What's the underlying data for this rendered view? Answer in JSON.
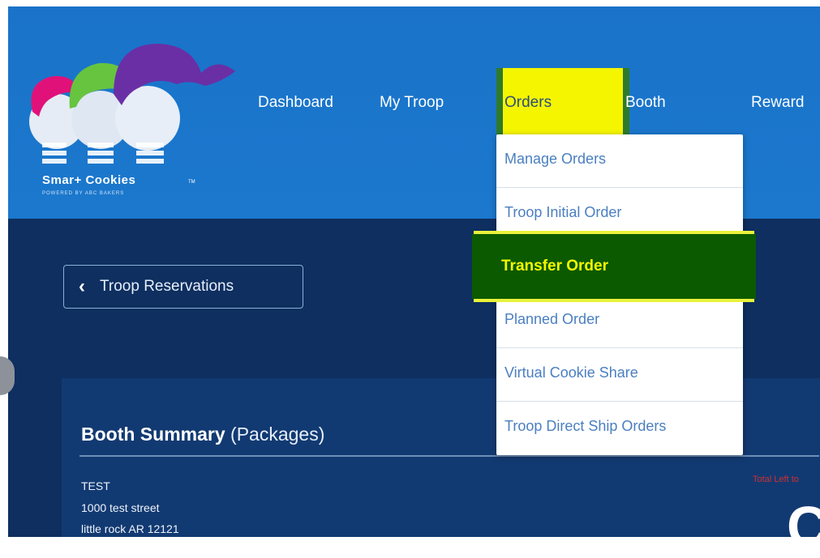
{
  "logo": {
    "text": "Smar+ Cookies",
    "sub": "POWERED BY ABC BAKERS",
    "tm": "TM"
  },
  "nav": {
    "items": [
      {
        "label": "Dashboard"
      },
      {
        "label": "My Troop"
      },
      {
        "label": "Orders"
      },
      {
        "label": "Booth"
      },
      {
        "label": "Reward"
      }
    ]
  },
  "dropdown": {
    "items": [
      {
        "label": "Manage Orders"
      },
      {
        "label": "Troop Initial Order"
      },
      {
        "label": "Transfer Order"
      },
      {
        "label": "Planned Order"
      },
      {
        "label": "Virtual Cookie Share"
      },
      {
        "label": "Troop Direct Ship Orders"
      }
    ]
  },
  "back_button": {
    "label": "Troop Reservations"
  },
  "booth_summary": {
    "title": "Booth Summary",
    "subtitle": "(Packages)",
    "address_lines": [
      "TEST",
      "1000 test street",
      "little rock AR 12121"
    ],
    "note": "Total Left to",
    "big_value": "C"
  },
  "colors": {
    "header_blue": "#1b78cd",
    "content_navy": "#0e2f5f",
    "highlight_yellow": "#f5f500",
    "highlight_green": "#0b5a00"
  }
}
